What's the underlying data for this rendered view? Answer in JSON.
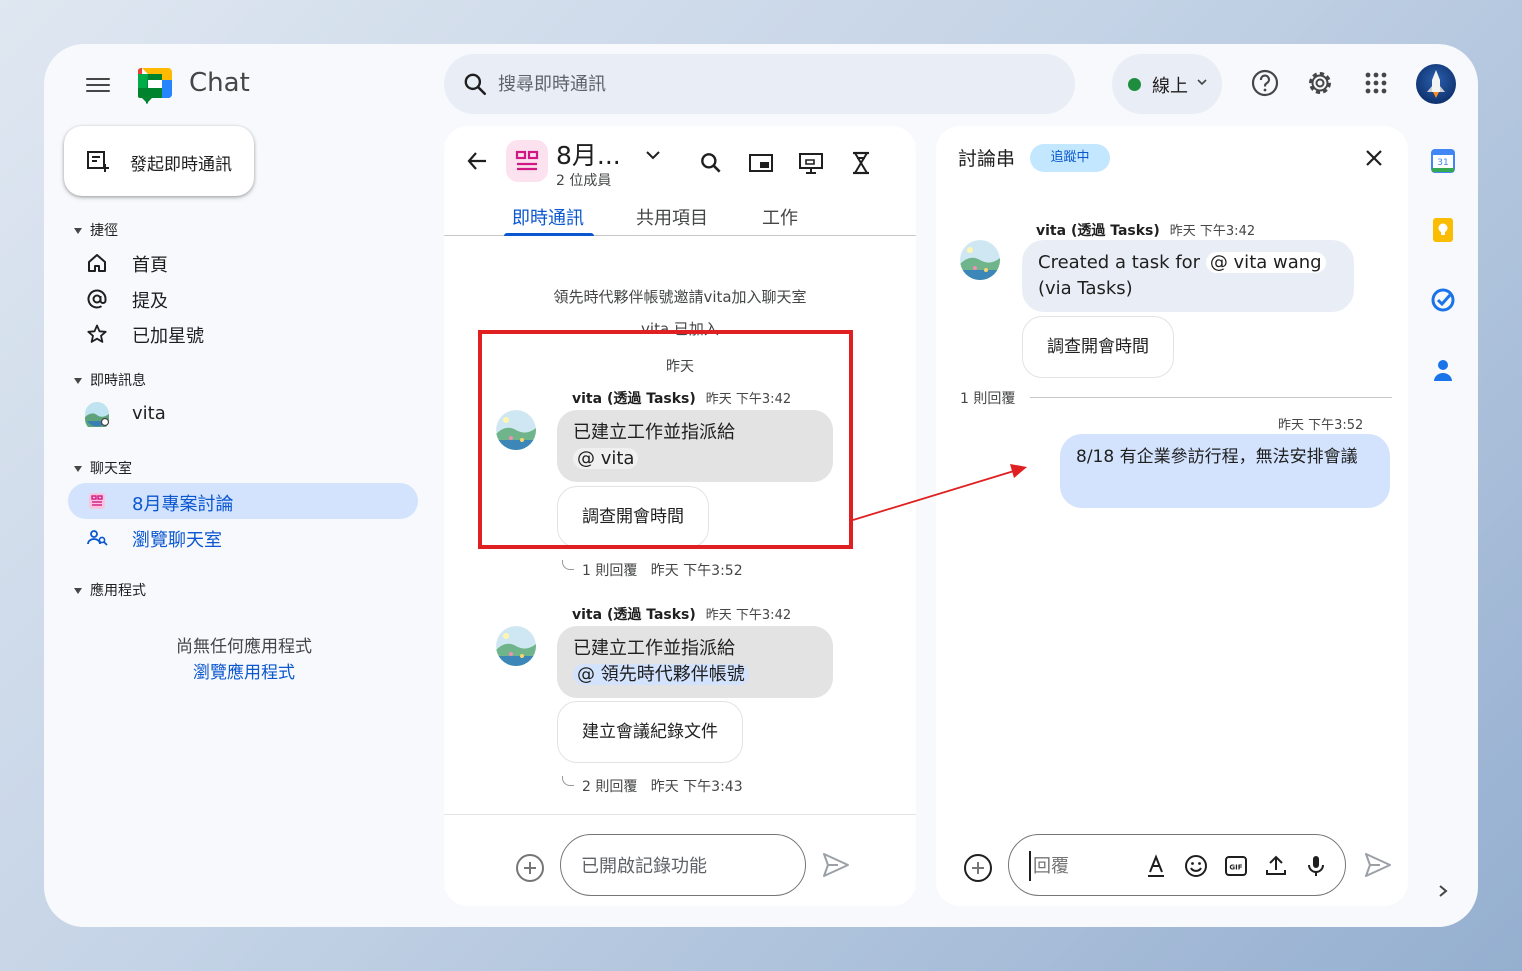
{
  "header": {
    "app_name": "Chat",
    "search_placeholder": "搜尋即時通訊",
    "status_label": "線上"
  },
  "sidebar": {
    "new_chat_label": "發起即時通訊",
    "shortcuts_title": "捷徑",
    "shortcuts": [
      {
        "label": "首頁",
        "icon": "home-icon"
      },
      {
        "label": "提及",
        "icon": "at-icon"
      },
      {
        "label": "已加星號",
        "icon": "star-icon"
      }
    ],
    "dm_title": "即時訊息",
    "dms": [
      {
        "label": "vita",
        "icon": "avatar"
      }
    ],
    "rooms_title": "聊天室",
    "rooms": [
      {
        "label": "8月專案討論",
        "icon": "room-icon",
        "active": true
      },
      {
        "label": "瀏覽聊天室",
        "icon": "browse-rooms-icon"
      }
    ],
    "apps_title": "應用程式",
    "no_apps_text": "尚無任何應用程式",
    "browse_apps_label": "瀏覽應用程式"
  },
  "room": {
    "title": "8月...",
    "members": "2 位成員",
    "tabs": [
      "即時通訊",
      "共用項目",
      "工作"
    ],
    "active_tab": 0,
    "system_messages": [
      "領先時代夥伴帳號邀請vita加入聊天室",
      "vita 已加入"
    ],
    "date_divider": "昨天",
    "messages": [
      {
        "sender": "vita (透過 Tasks)",
        "time": "昨天 下午3:42",
        "text": "已建立工作並指派給",
        "mention": "@ vita",
        "task": "調查開會時間",
        "reply_count": "1 則回覆",
        "reply_time": "昨天 下午3:52"
      },
      {
        "sender": "vita (透過 Tasks)",
        "time": "昨天 下午3:42",
        "text": "已建立工作並指派給",
        "mention": "@ 領先時代夥伴帳號",
        "task": "建立會議紀錄文件",
        "reply_count": "2 則回覆",
        "reply_time": "昨天 下午3:43"
      }
    ],
    "compose_placeholder": "已開啟記錄功能"
  },
  "thread": {
    "title": "討論串",
    "badge": "追蹤中",
    "original": {
      "sender": "vita (透過 Tasks)",
      "time": "昨天 下午3:42",
      "text_before": "Created a task for",
      "mention": "@ vita wang",
      "text_after": "(via Tasks)",
      "task": "調查開會時間"
    },
    "reply_count": "1 則回覆",
    "my_reply_time": "昨天 下午3:52",
    "my_reply": "8/18 有企業參訪行程，無法安排會議",
    "compose_placeholder": "回覆"
  },
  "colors": {
    "accent": "#0b57d0",
    "active_nav": "#d3e3fd",
    "highlight": "#e02020",
    "online": "#1e8e3e"
  }
}
